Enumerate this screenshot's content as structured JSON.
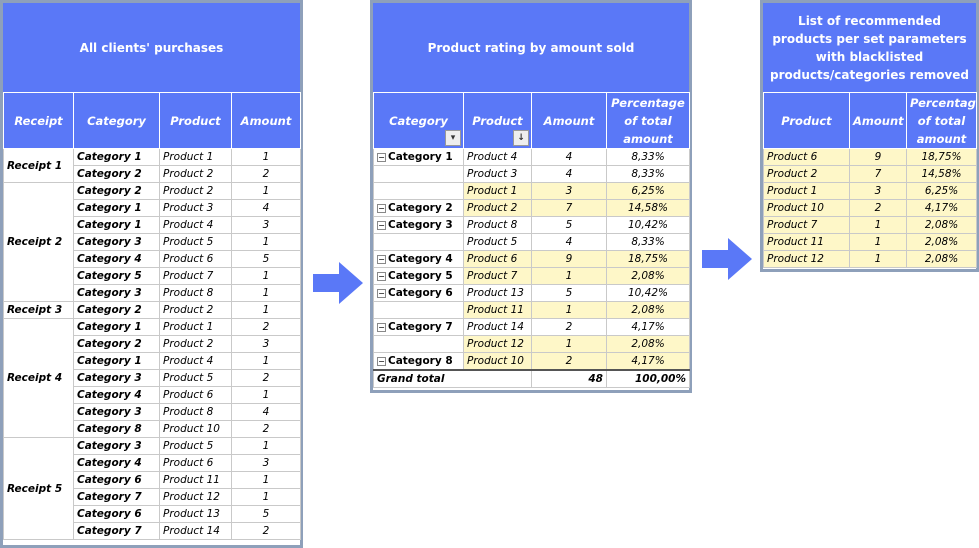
{
  "left": {
    "title": "All clients' purchases",
    "headers": [
      "Receipt",
      "Category",
      "Product",
      "Amount"
    ],
    "groups": [
      {
        "receipt": "Receipt 1",
        "rows": [
          [
            "Category 1",
            "Product 1",
            "1"
          ],
          [
            "Category 2",
            "Product 2",
            "2"
          ]
        ]
      },
      {
        "receipt": "Receipt 2",
        "rows": [
          [
            "Category 2",
            "Product 2",
            "1"
          ],
          [
            "Category 1",
            "Product 3",
            "4"
          ],
          [
            "Category 1",
            "Product 4",
            "3"
          ],
          [
            "Category 3",
            "Product 5",
            "1"
          ],
          [
            "Category 4",
            "Product 6",
            "5"
          ],
          [
            "Category 5",
            "Product 7",
            "1"
          ],
          [
            "Category 3",
            "Product 8",
            "1"
          ]
        ]
      },
      {
        "receipt": "Receipt 3",
        "rows": [
          [
            "Category 2",
            "Product 2",
            "1"
          ]
        ]
      },
      {
        "receipt": "Receipt 4",
        "rows": [
          [
            "Category 1",
            "Product 1",
            "2"
          ],
          [
            "Category 2",
            "Product 2",
            "3"
          ],
          [
            "Category 1",
            "Product 4",
            "1"
          ],
          [
            "Category 3",
            "Product 5",
            "2"
          ],
          [
            "Category 4",
            "Product 6",
            "1"
          ],
          [
            "Category 3",
            "Product 8",
            "4"
          ],
          [
            "Category 8",
            "Product 10",
            "2"
          ]
        ]
      },
      {
        "receipt": "Receipt 5",
        "rows": [
          [
            "Category 3",
            "Product 5",
            "1"
          ],
          [
            "Category 4",
            "Product 6",
            "3"
          ],
          [
            "Category 6",
            "Product 11",
            "1"
          ],
          [
            "Category 7",
            "Product 12",
            "1"
          ],
          [
            "Category 6",
            "Product 13",
            "5"
          ],
          [
            "Category 7",
            "Product 14",
            "2"
          ]
        ]
      }
    ]
  },
  "middle": {
    "title": "Product rating by amount sold",
    "headers": [
      "Category",
      "Product",
      "Amount",
      "Percentage of total amount"
    ],
    "rows": [
      {
        "cat": "Category 1",
        "prod": "Product 4",
        "amt": "4",
        "pct": "8,33%",
        "hl": false
      },
      {
        "cat": "",
        "prod": "Product 3",
        "amt": "4",
        "pct": "8,33%",
        "hl": false
      },
      {
        "cat": "",
        "prod": "Product 1",
        "amt": "3",
        "pct": "6,25%",
        "hl": true
      },
      {
        "cat": "Category 2",
        "prod": "Product 2",
        "amt": "7",
        "pct": "14,58%",
        "hl": true
      },
      {
        "cat": "Category 3",
        "prod": "Product 8",
        "amt": "5",
        "pct": "10,42%",
        "hl": false
      },
      {
        "cat": "",
        "prod": "Product 5",
        "amt": "4",
        "pct": "8,33%",
        "hl": false
      },
      {
        "cat": "Category 4",
        "prod": "Product 6",
        "amt": "9",
        "pct": "18,75%",
        "hl": true
      },
      {
        "cat": "Category 5",
        "prod": "Product 7",
        "amt": "1",
        "pct": "2,08%",
        "hl": true
      },
      {
        "cat": "Category 6",
        "prod": "Product 13",
        "amt": "5",
        "pct": "10,42%",
        "hl": false
      },
      {
        "cat": "",
        "prod": "Product 11",
        "amt": "1",
        "pct": "2,08%",
        "hl": true
      },
      {
        "cat": "Category 7",
        "prod": "Product 14",
        "amt": "2",
        "pct": "4,17%",
        "hl": false
      },
      {
        "cat": "",
        "prod": "Product 12",
        "amt": "1",
        "pct": "2,08%",
        "hl": true
      },
      {
        "cat": "Category 8",
        "prod": "Product 10",
        "amt": "2",
        "pct": "4,17%",
        "hl": true
      }
    ],
    "total": {
      "label": "Grand total",
      "amt": "48",
      "pct": "100,00%"
    },
    "expand_glyph": "⊟",
    "filter_glyph": "▾",
    "sort_glyph": "↓"
  },
  "right": {
    "title": "List of recommended products per set parameters with blacklisted products/categories removed",
    "headers": [
      "Product",
      "Amount",
      "Percentage of total amount"
    ],
    "rows": [
      [
        "Product 6",
        "9",
        "18,75%"
      ],
      [
        "Product 2",
        "7",
        "14,58%"
      ],
      [
        "Product 1",
        "3",
        "6,25%"
      ],
      [
        "Product 10",
        "2",
        "4,17%"
      ],
      [
        "Product 7",
        "1",
        "2,08%"
      ],
      [
        "Product 11",
        "1",
        "2,08%"
      ],
      [
        "Product 12",
        "1",
        "2,08%"
      ]
    ]
  },
  "colors": {
    "header": "#5a78f7",
    "highlight": "#fef7c8",
    "arrow": "#5a78f7",
    "border": "#8ea0ba"
  }
}
